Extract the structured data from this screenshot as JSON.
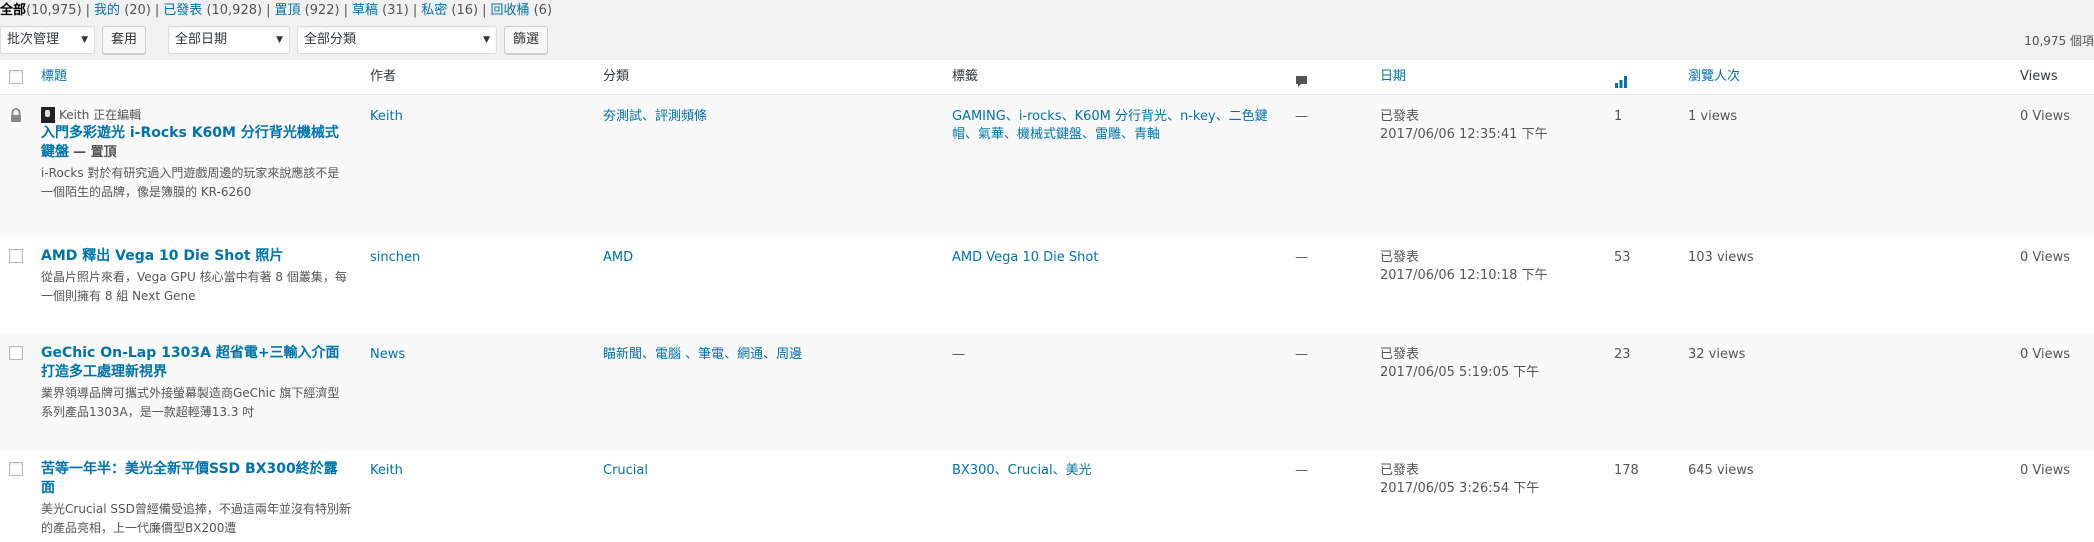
{
  "filters": [
    {
      "label": "全部",
      "count": "(10,975)",
      "current": true
    },
    {
      "label": "我的",
      "count": "(20)"
    },
    {
      "label": "已發表",
      "count": "(10,928)"
    },
    {
      "label": "置頂",
      "count": "(922)"
    },
    {
      "label": "草稿",
      "count": "(31)"
    },
    {
      "label": "私密",
      "count": "(16)"
    },
    {
      "label": "回收桶",
      "count": "(6)"
    }
  ],
  "toolbar": {
    "bulk_action": "批次管理",
    "apply_label": "套用",
    "date_filter": "全部日期",
    "category_filter": "全部分類",
    "filter_label": "篩選",
    "total_items": "10,975 個項"
  },
  "columns": {
    "title": "標題",
    "author": "作者",
    "categories": "分類",
    "tags": "標籤",
    "date": "日期",
    "views_cn": "瀏覽人次",
    "views": "Views"
  },
  "posts": [
    {
      "editing_notice": "Keith 正在編輯",
      "title": "入門多彩遊光 i-Rocks K60M 分行背光機械式鍵盤",
      "state": "— 置頂",
      "excerpt": "i-Rocks 對於有研究過入門遊戲周邊的玩家來說應該不是一個陌生的品牌，像是簿膜的 KR-6260",
      "author": "Keith",
      "categories": "夯測試、評測頻條",
      "tags": "GAMING、i-rocks、K60M 分行背光、n-key、二色鍵帽、氣華、機械式鍵盤、雷雕、青軸",
      "comments": "—",
      "status": "已發表",
      "date": "2017/06/06 12:35:41 下午",
      "stat": "1",
      "views_cn": "1 views",
      "views": "0 Views"
    },
    {
      "title": "AMD 釋出 Vega 10 Die Shot 照片",
      "excerpt": "從晶片照片來看，Vega GPU 核心當中有著 8 個叢集，每一個則擁有 8 組 Next Gene",
      "author": "sinchen",
      "categories": "AMD",
      "tags": "AMD Vega 10 Die Shot",
      "comments": "—",
      "status": "已發表",
      "date": "2017/06/06 12:10:18 下午",
      "stat": "53",
      "views_cn": "103 views",
      "views": "0 Views"
    },
    {
      "title": "GeChic On-Lap 1303A 超省電+三輸入介面 打造多工處理新視界",
      "excerpt": "業界領導品牌可攜式外接螢幕製造商GeChic 旗下經濟型系列產品1303A，是一款超輕薄13.3 吋",
      "author": "News",
      "categories": "瞄新聞、電腦 、筆電、網通、周邊",
      "tags": "—",
      "comments": "—",
      "status": "已發表",
      "date": "2017/06/05 5:19:05 下午",
      "stat": "23",
      "views_cn": "32 views",
      "views": "0 Views"
    },
    {
      "title": "苦等一年半：美光全新平價SSD BX300終於露面",
      "excerpt": " 美光Crucial SSD曾經備受追捧，不過這兩年並沒有特別新的產品亮相，上一代廉價型BX200遭",
      "author": "Keith",
      "categories": "Crucial",
      "tags": "BX300、Crucial、美光",
      "comments": "—",
      "status": "已發表",
      "date": "2017/06/05 3:26:54 下午",
      "stat": "178",
      "views_cn": "645 views",
      "views": "0 Views"
    }
  ]
}
